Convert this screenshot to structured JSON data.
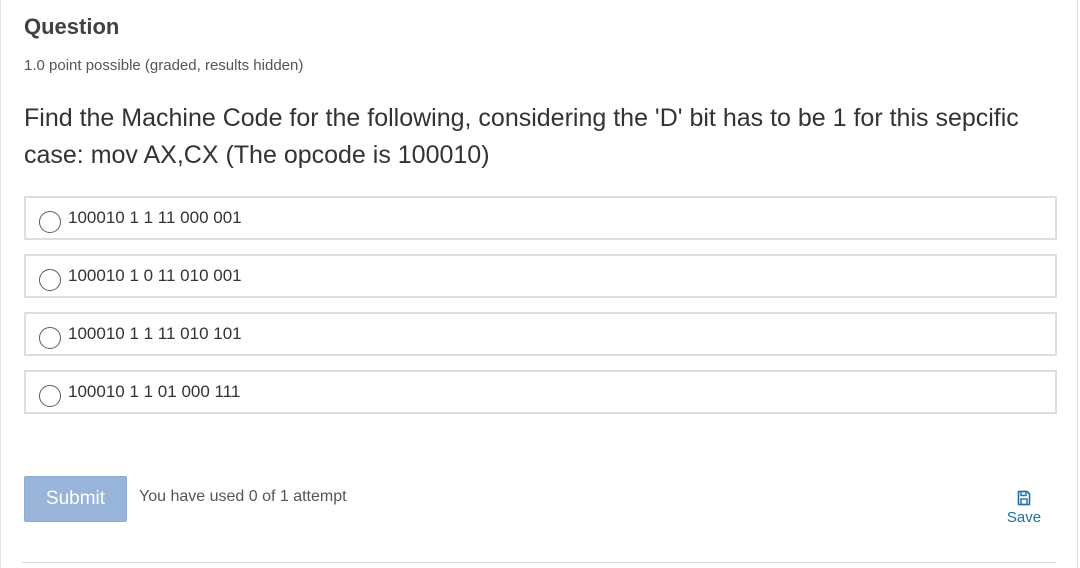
{
  "question": {
    "title": "Question",
    "points": "1.0 point possible (graded, results hidden)",
    "prompt": "Find the Machine Code for the following, considering the 'D' bit has to be 1 for this sepcific case: mov AX,CX (The opcode is 100010)"
  },
  "choices": [
    {
      "label": "100010 1 1 11 000 001",
      "selected": false
    },
    {
      "label": "100010 1 0 11 010 001",
      "selected": false
    },
    {
      "label": "100010 1 1 11 010 101",
      "selected": false
    },
    {
      "label": "100010 1 1 01 000 111",
      "selected": false
    }
  ],
  "actions": {
    "submit_label": "Submit",
    "attempts_text": "You have used 0 of 1 attempt",
    "save_label": "Save",
    "save_icon": "save-icon"
  },
  "colors": {
    "submit_bg": "#98b4d8",
    "link": "#1f6fa5",
    "border": "#dedede"
  }
}
